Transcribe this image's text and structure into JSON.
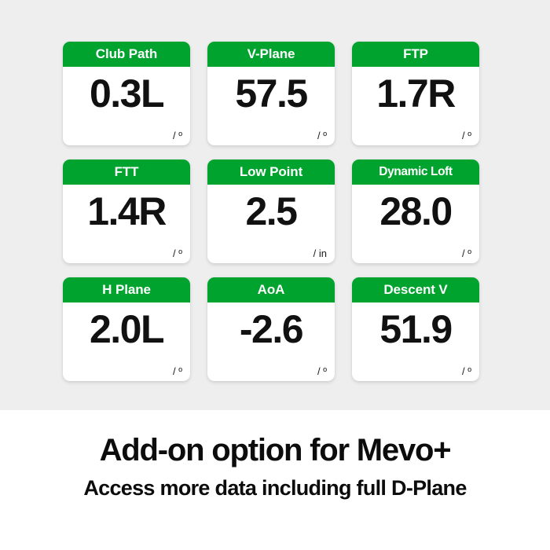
{
  "theme": {
    "panel_background": "#eeeeee",
    "caption_background": "#ffffff",
    "header_green": "#00A32E",
    "header_text": "#ffffff",
    "value_text": "#111111"
  },
  "metrics": {
    "cards": [
      {
        "label": "Club Path",
        "value": "0.3L",
        "unit": "/ º"
      },
      {
        "label": "V-Plane",
        "value": "57.5",
        "unit": "/ º"
      },
      {
        "label": "FTP",
        "value": "1.7R",
        "unit": "/ º"
      },
      {
        "label": "FTT",
        "value": "1.4R",
        "unit": "/ º"
      },
      {
        "label": "Low Point",
        "value": "2.5",
        "unit": "/ in"
      },
      {
        "label": "Dynamic Loft",
        "value": "28.0",
        "unit": "/ º"
      },
      {
        "label": "H Plane",
        "value": "2.0L",
        "unit": "/ º"
      },
      {
        "label": "AoA",
        "value": "-2.6",
        "unit": "/ º"
      },
      {
        "label": "Descent V",
        "value": "51.9",
        "unit": "/ º"
      }
    ]
  },
  "caption": {
    "headline": "Add-on option for Mevo+",
    "subline": "Access more data including full D-Plane"
  }
}
